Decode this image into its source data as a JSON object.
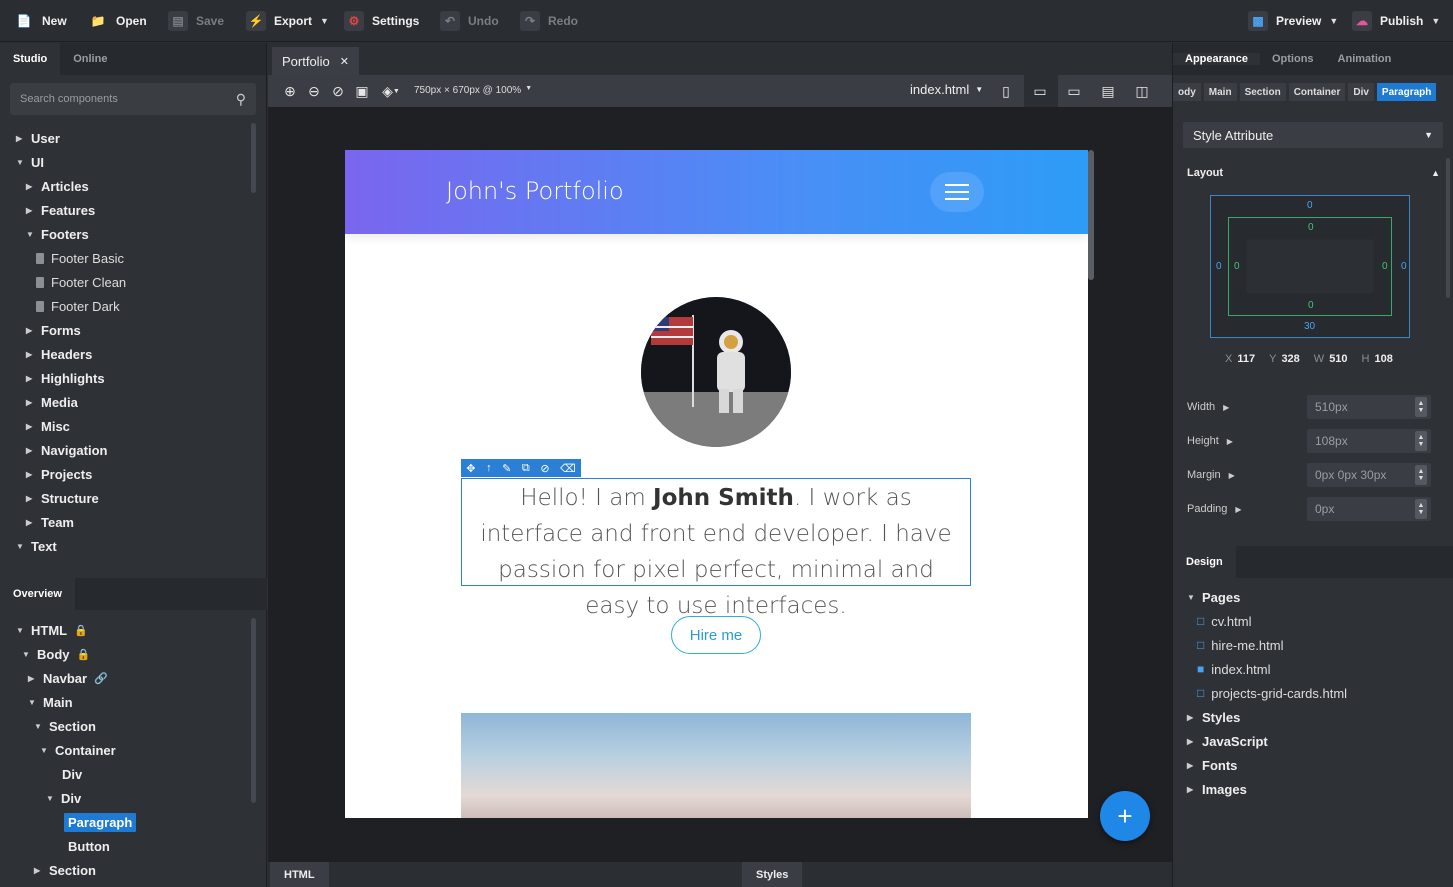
{
  "toolbar": {
    "new": "New",
    "open": "Open",
    "save": "Save",
    "export": "Export",
    "settings": "Settings",
    "undo": "Undo",
    "redo": "Redo",
    "preview": "Preview",
    "publish": "Publish"
  },
  "left": {
    "tabs": [
      "Studio",
      "Online"
    ],
    "search_placeholder": "Search components",
    "components": [
      "User",
      "UI",
      "Articles",
      "Features",
      "Footers",
      "Footer Basic",
      "Footer Clean",
      "Footer Dark",
      "Forms",
      "Headers",
      "Highlights",
      "Media",
      "Misc",
      "Navigation",
      "Projects",
      "Structure",
      "Team",
      "Text"
    ],
    "overview_tab": "Overview",
    "overview": [
      "HTML",
      "Body",
      "Navbar",
      "Main",
      "Section",
      "Container",
      "Div",
      "Div",
      "Paragraph",
      "Button",
      "Section"
    ]
  },
  "center": {
    "doc_tab": "Portfolio",
    "size_label": "750px × 670px @ 100%",
    "page_select": "index.html",
    "site": {
      "brand": "John's Portfolio",
      "para_pre": "Hello! I am ",
      "para_name": "John Smith",
      "para_post": ". I work as interface and front end developer. I have passion for pixel perfect, minimal and easy to use interfaces.",
      "hire": "Hire me"
    },
    "bottom_tabs": [
      "HTML",
      "Styles"
    ],
    "fab": "+"
  },
  "right": {
    "tabs": [
      "Appearance",
      "Options",
      "Animation"
    ],
    "crumbs": [
      "ody",
      "Main",
      "Section",
      "Container",
      "Div",
      "Paragraph"
    ],
    "style_attr": "Style Attribute",
    "layout_title": "Layout",
    "box": {
      "m_top": "0",
      "m_right": "0",
      "m_bottom": "30",
      "m_left": "0",
      "p_top": "0",
      "p_right": "0",
      "p_bottom": "0",
      "p_left": "0"
    },
    "dims": {
      "x": "117",
      "y": "328",
      "w": "510",
      "h": "108"
    },
    "props": [
      {
        "label": "Width",
        "value": "510px"
      },
      {
        "label": "Height",
        "value": "108px"
      },
      {
        "label": "Margin",
        "value": "0px 0px 30px"
      },
      {
        "label": "Padding",
        "value": "0px"
      }
    ],
    "design_tab": "Design",
    "design": [
      "Pages",
      "cv.html",
      "hire-me.html",
      "index.html",
      "projects-grid-cards.html",
      "Styles",
      "JavaScript",
      "Fonts",
      "Images"
    ]
  },
  "colors": {
    "accent": "#1f7ad3",
    "nav_start": "#7a66ee",
    "nav_end": "#2d9cf7"
  }
}
